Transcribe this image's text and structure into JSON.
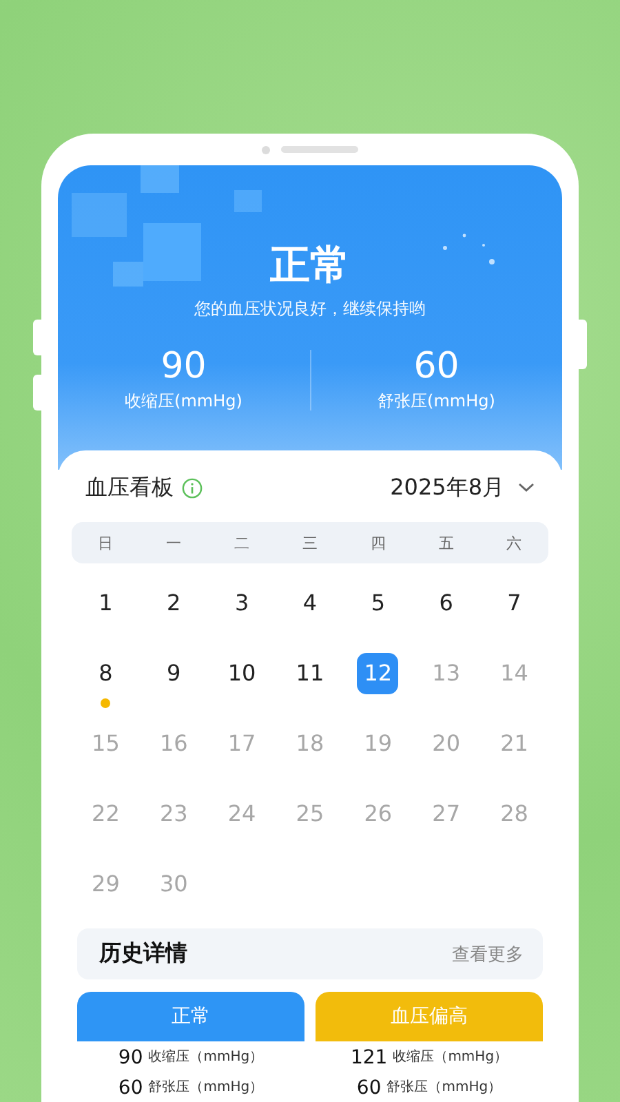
{
  "summary": {
    "status": "正常",
    "message": "您的血压状况良好，继续保持哟",
    "stats": [
      {
        "value": "90",
        "label": "收缩压(mmHg)"
      },
      {
        "value": "60",
        "label": "舒张压(mmHg)"
      }
    ]
  },
  "board": {
    "title": "血压看板",
    "month": "2025年8月",
    "weekdays": [
      "日",
      "一",
      "二",
      "三",
      "四",
      "五",
      "六"
    ],
    "weeks": [
      [
        {
          "day": "1",
          "dimmed": false,
          "selected": false
        },
        {
          "day": "2",
          "dimmed": false,
          "selected": false
        },
        {
          "day": "3",
          "dimmed": false,
          "selected": false
        },
        {
          "day": "4",
          "dimmed": false,
          "selected": false
        },
        {
          "day": "5",
          "dimmed": false,
          "selected": false
        },
        {
          "day": "6",
          "dimmed": false,
          "selected": false
        },
        {
          "day": "7",
          "dimmed": false,
          "selected": false
        }
      ],
      [
        {
          "day": "8",
          "dimmed": false,
          "selected": false,
          "color": "#f5b800"
        },
        {
          "day": "9",
          "dimmed": false,
          "selected": false
        },
        {
          "day": "10",
          "dimmed": false,
          "selected": false
        },
        {
          "day": "11",
          "dimmed": false,
          "selected": false
        },
        {
          "day": "12",
          "dimmed": false,
          "selected": true
        },
        {
          "day": "13",
          "dimmed": true,
          "selected": false
        },
        {
          "day": "14",
          "dimmed": true,
          "selected": false
        }
      ],
      [
        {
          "day": "15",
          "dimmed": true,
          "selected": false
        },
        {
          "day": "16",
          "dimmed": true,
          "selected": false
        },
        {
          "day": "17",
          "dimmed": true,
          "selected": false
        },
        {
          "day": "18",
          "dimmed": true,
          "selected": false
        },
        {
          "day": "19",
          "dimmed": true,
          "selected": false
        },
        {
          "day": "20",
          "dimmed": true,
          "selected": false
        },
        {
          "day": "21",
          "dimmed": true,
          "selected": false
        }
      ],
      [
        {
          "day": "22",
          "dimmed": true,
          "selected": false
        },
        {
          "day": "23",
          "dimmed": true,
          "selected": false
        },
        {
          "day": "24",
          "dimmed": true,
          "selected": false
        },
        {
          "day": "25",
          "dimmed": true,
          "selected": false
        },
        {
          "day": "26",
          "dimmed": true,
          "selected": false
        },
        {
          "day": "27",
          "dimmed": true,
          "selected": false
        },
        {
          "day": "28",
          "dimmed": true,
          "selected": false
        }
      ],
      [
        {
          "day": "29",
          "dimmed": true,
          "selected": false
        },
        {
          "day": "30",
          "dimmed": true,
          "selected": false
        }
      ]
    ]
  },
  "history": {
    "title": "历史详情",
    "more": "查看更多",
    "cards": [
      {
        "title": "正常",
        "color": "#2e95f5",
        "rows": [
          {
            "value": "90",
            "label": "收缩压（mmHg）"
          },
          {
            "value": "60",
            "label": "舒张压（mmHg）"
          }
        ]
      },
      {
        "title": "血压偏高",
        "color": "#f2bc0c",
        "rows": [
          {
            "value": "121",
            "label": "收缩压（mmHg）"
          },
          {
            "value": "60",
            "label": "舒张压（mmHg）"
          }
        ]
      }
    ]
  }
}
